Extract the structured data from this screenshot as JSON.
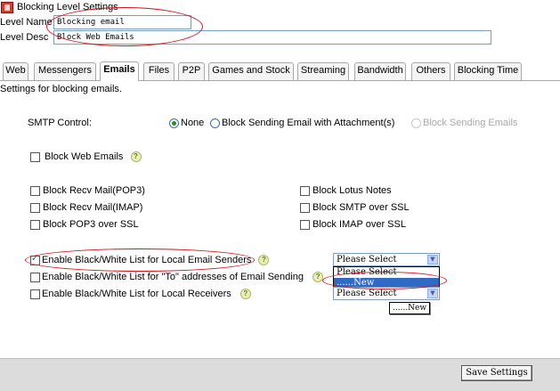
{
  "window": {
    "title": "Blocking Level Settings",
    "icon": "level-settings-icon"
  },
  "form": {
    "level_name_label": "Level Name",
    "level_name_value": "Blocking email",
    "level_desc_label": "Level Desc",
    "level_desc_value": "Block Web Emails"
  },
  "tabs": [
    {
      "label": "Web",
      "active": false
    },
    {
      "label": "Messengers",
      "active": false
    },
    {
      "label": "Emails",
      "active": true
    },
    {
      "label": "Files",
      "active": false
    },
    {
      "label": "P2P",
      "active": false
    },
    {
      "label": "Games and Stock",
      "active": false
    },
    {
      "label": "Streaming",
      "active": false
    },
    {
      "label": "Bandwidth",
      "active": false
    },
    {
      "label": "Others",
      "active": false
    },
    {
      "label": "Blocking Time",
      "active": false
    }
  ],
  "emails": {
    "description": "Settings for blocking emails.",
    "smtp": {
      "label": "SMTP Control:",
      "options": [
        {
          "label": "None",
          "checked": true,
          "disabled": false
        },
        {
          "label": "Block Sending Email with Attachment(s)",
          "checked": false,
          "disabled": false
        },
        {
          "label": "Block Sending Emails",
          "checked": false,
          "disabled": true
        }
      ]
    },
    "block_web_emails": {
      "label": "Block Web Emails",
      "checked": false
    },
    "left_options": [
      {
        "label": "Block Recv Mail(POP3)",
        "checked": false
      },
      {
        "label": "Block Recv Mail(IMAP)",
        "checked": false
      },
      {
        "label": "Block POP3 over SSL",
        "checked": false
      }
    ],
    "right_options": [
      {
        "label": "Block Lotus Notes",
        "checked": false
      },
      {
        "label": "Block SMTP over SSL",
        "checked": false
      },
      {
        "label": "Block IMAP over SSL",
        "checked": false
      }
    ],
    "lists": [
      {
        "label": "Enable Black/White List for Local Email Senders",
        "checked": true
      },
      {
        "label": "Enable Black/White List for \"To\" addresses of Email Sending",
        "checked": false
      },
      {
        "label": "Enable Black/White List for Local Receivers",
        "checked": false
      }
    ],
    "select_value": "Please Select",
    "dropdown_options": [
      "Please Select",
      "......New"
    ],
    "dropdown_selected_index": 1,
    "select3_value": "Please Select",
    "tooltip_text": "......New"
  },
  "footer": {
    "save_label": "Save Settings"
  },
  "colors": {
    "annotation_red": "#d0141a",
    "highlight_blue": "#316ac5"
  }
}
